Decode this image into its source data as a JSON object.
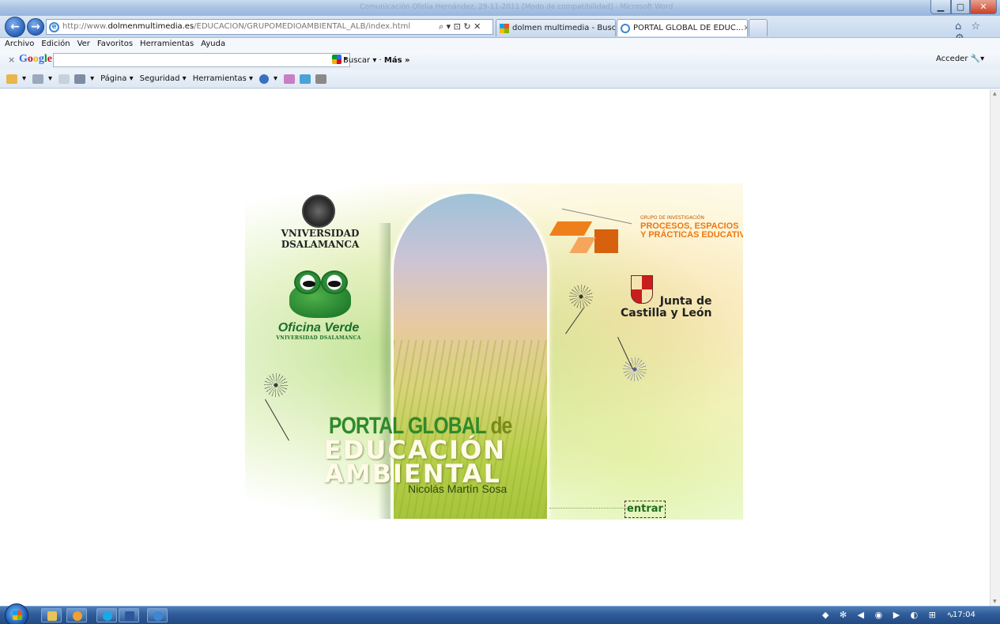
{
  "browser": {
    "window_title": "Comunicación Ofelia Hernández, 29-11-2011 [Modo de compatibilidad] - Microsoft Word",
    "address": {
      "url_prefix": "http://www.",
      "url_domain": "dolmenmultimedia.es",
      "url_path": "/EDUCACION/GRUPOMEDIOAMBIENTAL_ALB/index.html",
      "controls": "⌕ ▾ ⊡ ↻ ✕"
    },
    "tabs": [
      {
        "label": "dolmen multimedia - Buscar c...",
        "active": false
      },
      {
        "label": "PORTAL GLOBAL DE EDUC...",
        "active": true,
        "close": "×"
      }
    ],
    "right_icons": "⌂ ☆ ⚙"
  },
  "menu": [
    "Archivo",
    "Edición",
    "Ver",
    "Favoritos",
    "Herramientas",
    "Ayuda"
  ],
  "google_toolbar": {
    "close": "×",
    "logo": "Google",
    "search_value": "",
    "dropdown": "▾",
    "buscar": "Buscar ▾",
    "mas": "Más »",
    "acceder": "Acceder"
  },
  "command_bar": {
    "pagina": "Página ▾",
    "seguridad": "Seguridad ▾",
    "herramientas": "Herramientas ▾"
  },
  "page": {
    "universidad": [
      "VNIVERSIDAD",
      "DSALAMANCA"
    ],
    "oficina_title": "Oficina Verde",
    "oficina_sub": "VNIVERSIDAD DSALAMANCA",
    "grupo_small": "GRUPO DE INVESTIGACIÓN",
    "grupo_big": [
      "PROCESOS, ESPACIOS",
      "Y PRÁCTICAS EDUCATIVAS"
    ],
    "junta": [
      "Junta de",
      "Castilla y León"
    ],
    "portal_word1": "PORTAL GLOBAL ",
    "portal_word2": "de",
    "line2": "EDUCACIÓN",
    "line3": "AMBIENTAL",
    "author": "Nicolás Martín Sosa",
    "entrar": "entrar"
  },
  "taskbar": {
    "clock": "17:04",
    "tray": "◆ ✻ ◀ ◉ ▶ ◐ ⊞ ∿"
  },
  "colors": {
    "accent_orange": "#ef7712",
    "oficina_green": "#1b6e2c",
    "portal_green": "#2f8a2a",
    "taskbar_blue": "#2f5c98"
  }
}
